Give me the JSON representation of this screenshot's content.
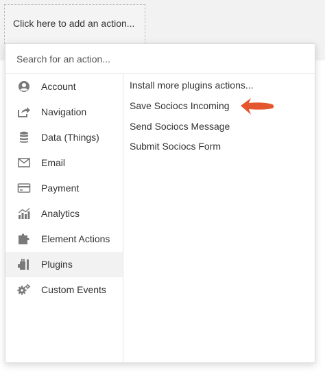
{
  "trigger": {
    "label": "Click here to add an action..."
  },
  "search": {
    "placeholder": "Search for an action..."
  },
  "categories": [
    {
      "label": "Account",
      "icon": "account-icon"
    },
    {
      "label": "Navigation",
      "icon": "navigation-icon"
    },
    {
      "label": "Data (Things)",
      "icon": "database-icon"
    },
    {
      "label": "Email",
      "icon": "email-icon"
    },
    {
      "label": "Payment",
      "icon": "payment-icon"
    },
    {
      "label": "Analytics",
      "icon": "analytics-icon"
    },
    {
      "label": "Element Actions",
      "icon": "element-actions-icon"
    },
    {
      "label": "Plugins",
      "icon": "plugins-icon",
      "selected": true
    },
    {
      "label": "Custom Events",
      "icon": "custom-events-icon"
    }
  ],
  "actions": [
    {
      "label": "Install more plugins actions..."
    },
    {
      "label": "Save Sociocs Incoming"
    },
    {
      "label": "Send Sociocs Message"
    },
    {
      "label": "Submit Sociocs Form"
    }
  ],
  "colors": {
    "arrow": "#e4572e",
    "icon": "#7a7a7a",
    "text": "#333333",
    "selected_bg": "#f2f2f2"
  }
}
